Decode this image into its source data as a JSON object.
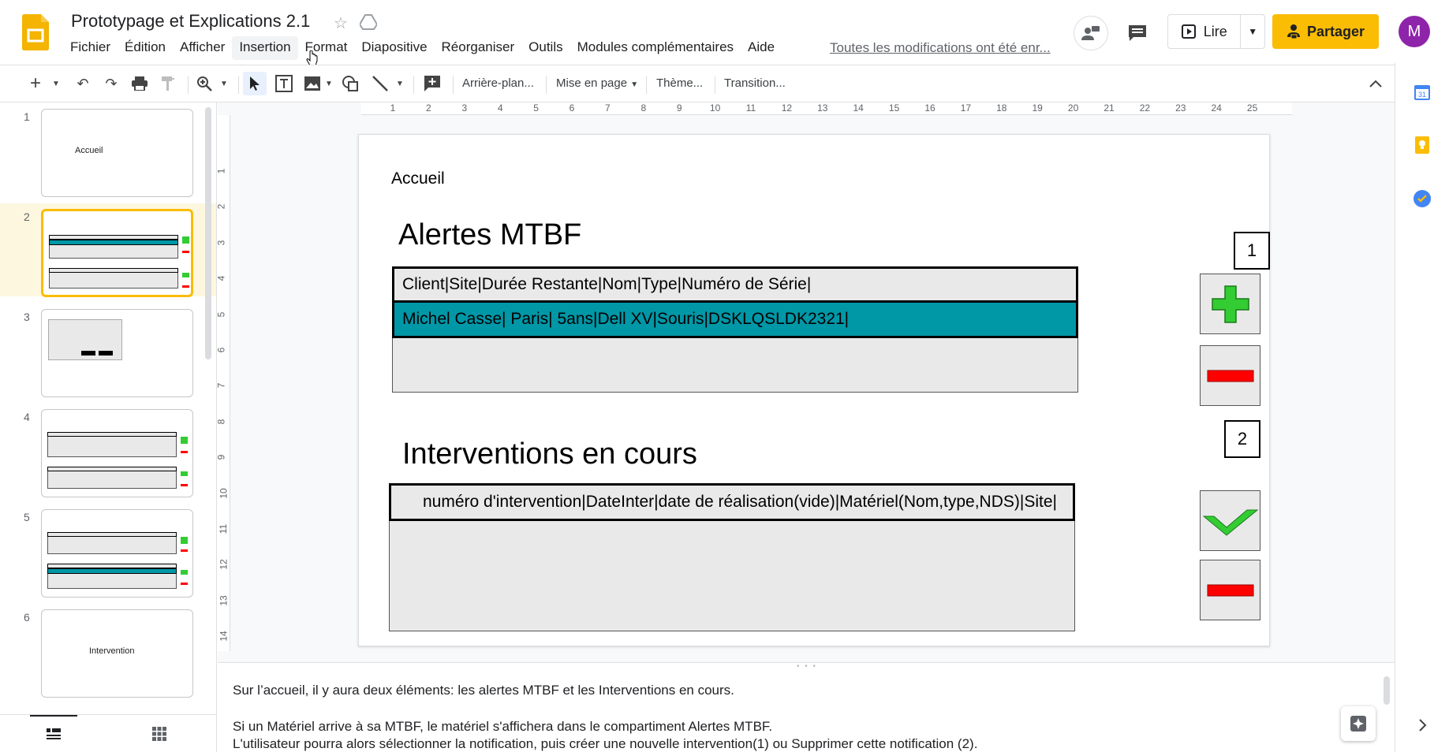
{
  "header": {
    "title": "Prototypage et Explications 2.1",
    "menus": [
      "Fichier",
      "Édition",
      "Afficher",
      "Insertion",
      "Format",
      "Diapositive",
      "Réorganiser",
      "Outils",
      "Modules complémentaires",
      "Aide"
    ],
    "active_menu": "Insertion",
    "saved_status": "Toutes les modifications ont été enr...",
    "present_label": "Lire",
    "share_label": "Partager",
    "avatar_initial": "M"
  },
  "toolbar": {
    "background_label": "Arrière-plan...",
    "layout_label": "Mise en page",
    "theme_label": "Thème...",
    "transition_label": "Transition..."
  },
  "rulers": {
    "horizontal": [
      "1",
      "2",
      "3",
      "4",
      "5",
      "6",
      "7",
      "8",
      "9",
      "10",
      "11",
      "12",
      "13",
      "14",
      "15",
      "16",
      "17",
      "18",
      "19",
      "20",
      "21",
      "22",
      "23",
      "24",
      "25"
    ],
    "vertical": [
      "1",
      "2",
      "3",
      "4",
      "5",
      "6",
      "7",
      "8",
      "9",
      "10",
      "11",
      "12",
      "13",
      "14"
    ]
  },
  "filmstrip": {
    "slides": [
      {
        "num": "1",
        "label": "Accueil"
      },
      {
        "num": "2",
        "label": ""
      },
      {
        "num": "3",
        "label": ""
      },
      {
        "num": "4",
        "label": ""
      },
      {
        "num": "5",
        "label": ""
      },
      {
        "num": "6",
        "label": "Intervention"
      }
    ],
    "current": "2"
  },
  "slide": {
    "home": "Accueil",
    "section1_title": "Alertes MTBF",
    "section1_header": "Client|Site|Durée Restante|Nom|Type|Numéro de Série|",
    "section1_row": "Michel Casse| Paris| 5ans|Dell XV|Souris|DSKLQSLDK2321|",
    "marker1": "1",
    "section2_title": "Interventions en cours",
    "section2_header": "numéro d'intervention|DateInter|date de réalisation(vide)|Matériel(Nom,type,NDS)|Site|",
    "marker2": "2"
  },
  "notes": {
    "line1": "Sur l’accueil, il y aura deux éléments: les alertes MTBF et les Interventions en cours.",
    "line2": "Si un Matériel arrive à sa MTBF, le matériel s'affichera dans le compartiment Alertes MTBF.",
    "line3": "L'utilisateur pourra alors sélectionner la notification, puis créer une nouvelle intervention(1)  ou Supprimer cette notification (2)."
  },
  "colors": {
    "accent": "#fbbc04",
    "highlight_row": "#0097a7",
    "plus_green": "#33cc33",
    "minus_red": "#ff0000",
    "avatar": "#8e24aa"
  }
}
